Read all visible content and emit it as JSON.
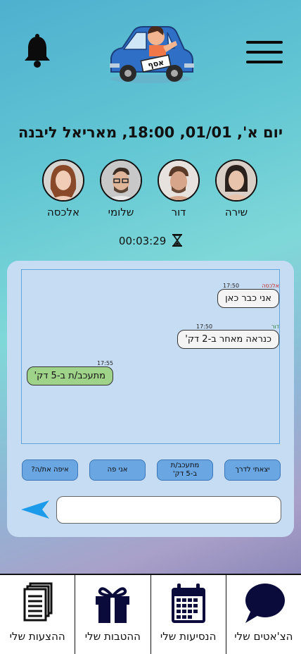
{
  "header": {
    "bell_icon": "bell-icon",
    "menu_icon": "hamburger-menu-icon",
    "logo_sign": "אסף"
  },
  "ride": {
    "title": "יום א', 01/01, 18:00, מאריאל ליבנה"
  },
  "participants": [
    {
      "name": "שירה"
    },
    {
      "name": "דור"
    },
    {
      "name": "שלומי"
    },
    {
      "name": "אלכסה"
    }
  ],
  "timer": {
    "value": "00:03:29",
    "icon": "hourglass-icon"
  },
  "chat": {
    "messages": [
      {
        "sender": "אלכסה",
        "time": "17:50",
        "text": "אני כבר כאן"
      },
      {
        "sender": "דור",
        "time": "17:50",
        "text": "כנראה מאחר ב-2 דק'"
      },
      {
        "sender": "",
        "time": "17:55",
        "text": "מתעכב/ת ב-5 דק'"
      }
    ],
    "quick_replies": [
      "יצאתי לדרך",
      "מתעכב/ת ב-5 דק'",
      "אני פה",
      "איפה את/ה?"
    ],
    "input_value": "",
    "send_icon": "send-arrow-icon"
  },
  "tabs": [
    {
      "label": "הצ'אטים שלי",
      "icon": "chat-bubble-icon"
    },
    {
      "label": "הנסיעות שלי",
      "icon": "calendar-icon"
    },
    {
      "label": "ההטבות שלי",
      "icon": "gift-icon"
    },
    {
      "label": "ההצעות שלי",
      "icon": "documents-icon"
    }
  ],
  "colors": {
    "accent": "#6aa6e2",
    "my_bubble": "#9fd389",
    "panel": "#c5dcf3"
  }
}
